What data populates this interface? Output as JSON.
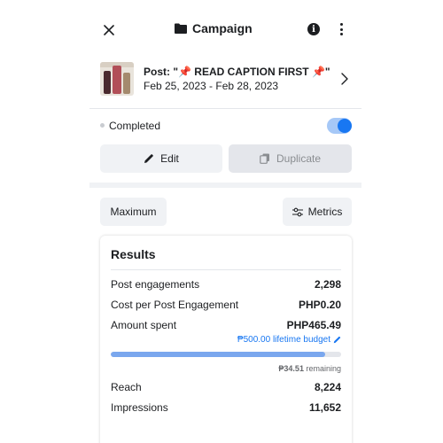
{
  "header": {
    "title": "Campaign",
    "close_icon": "close-icon",
    "folder_icon": "folder-icon",
    "info_icon": "info-icon",
    "more_icon": "more-vertical-icon"
  },
  "post": {
    "title": "Post: \"📌 READ CAPTION FIRST 📌\"",
    "dates": "Feb 25, 2023 - Feb 28, 2023"
  },
  "status": {
    "label": "Completed",
    "toggle_on": true
  },
  "actions": {
    "edit_label": "Edit",
    "duplicate_label": "Duplicate"
  },
  "filters": {
    "maximum_label": "Maximum",
    "metrics_label": "Metrics"
  },
  "results": {
    "title": "Results",
    "rows": [
      {
        "label": "Post engagements",
        "value": "2,298"
      },
      {
        "label": "Cost per Post Engagement",
        "value": "PHP0.20"
      },
      {
        "label": "Amount spent",
        "value": "PHP465.49"
      }
    ],
    "budget_label": "₱500.00 lifetime budget",
    "budget_spent_fraction": 0.931,
    "remaining_amount": "₱34.51",
    "remaining_text": "remaining",
    "more_rows": [
      {
        "label": "Reach",
        "value": "8,224"
      },
      {
        "label": "Impressions",
        "value": "11,652"
      }
    ]
  },
  "colors": {
    "accent": "#1877f2",
    "progress_fill": "#7aa7ee",
    "button_bg": "#f0f2f5"
  }
}
